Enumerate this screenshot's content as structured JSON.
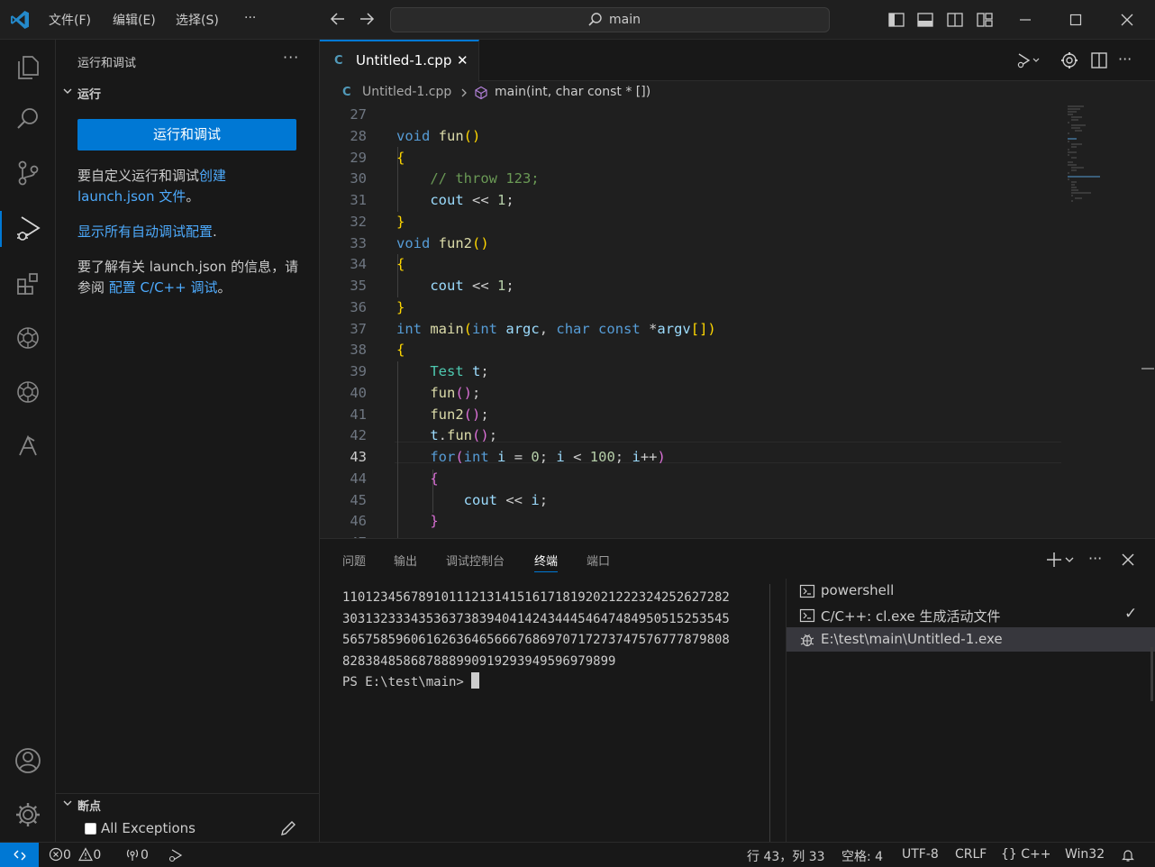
{
  "menu": [
    "文件(F)",
    "编辑(E)",
    "选择(S)",
    "···"
  ],
  "search": {
    "text": "main"
  },
  "sidebar": {
    "title": "运行和调试",
    "more": "···",
    "run_section": "运行",
    "run_button": "运行和调试",
    "customize_prefix": "要自定义运行和调试",
    "customize_link": "创建 launch.json 文件",
    "customize_suffix": "。",
    "show_all_link": "显示所有自动调试配置",
    "show_all_suffix": ".",
    "learn_prefix": "要了解有关 launch.json 的信息，请参阅 ",
    "learn_link": "配置 C/C++ 调试",
    "learn_suffix": "。",
    "breakpoints_section": "断点",
    "all_exceptions": "All Exceptions"
  },
  "editor": {
    "tab_icon": "C",
    "tab_label": "Untitled-1.cpp",
    "tab_close": "✕",
    "breadcrumb_file": "Untitled-1.cpp",
    "breadcrumb_symbol": "main(int, char const * [])",
    "current_line": 43,
    "lines": [
      {
        "n": "27",
        "t": ""
      },
      {
        "n": "28",
        "t": "void fun()"
      },
      {
        "n": "29",
        "t": "{"
      },
      {
        "n": "30",
        "t": "    // throw 123;"
      },
      {
        "n": "31",
        "t": "    cout << 1;"
      },
      {
        "n": "32",
        "t": "}"
      },
      {
        "n": "33",
        "t": "void fun2()"
      },
      {
        "n": "34",
        "t": "{"
      },
      {
        "n": "35",
        "t": "    cout << 1;"
      },
      {
        "n": "36",
        "t": "}"
      },
      {
        "n": "37",
        "t": "int main(int argc, char const *argv[])"
      },
      {
        "n": "38",
        "t": "{"
      },
      {
        "n": "39",
        "t": "    Test t;"
      },
      {
        "n": "40",
        "t": "    fun();"
      },
      {
        "n": "41",
        "t": "    fun2();"
      },
      {
        "n": "42",
        "t": "    t.fun();"
      },
      {
        "n": "43",
        "t": "    for(int i = 0; i < 100; i++)"
      },
      {
        "n": "44",
        "t": "    {"
      },
      {
        "n": "45",
        "t": "        cout << i;"
      },
      {
        "n": "46",
        "t": "    }"
      },
      {
        "n": "47",
        "t": ""
      }
    ]
  },
  "panel": {
    "tabs": [
      "问题",
      "输出",
      "调试控制台",
      "终端",
      "端口"
    ],
    "active_tab": "终端",
    "terminal_lines": [
      "110123456789101112131415161718192021222324252627282930313233343536373839404142434445464748495051525354555657585960616263646566676869707172737475767778798081828384858687888990919293949596979899",
      "303132333435363738394041424344454647484950515253545556575859606162636465666768697071727374757677787980818283848586878889909192939495969798999",
      "5657585960616263646566676869707172737475767778798081",
      "828384858687888990919293949596979899",
      "PS E:\\test\\main> "
    ],
    "terminal_display": [
      "110123456789101112131415161718192021222324252627282",
      "303132333435363738394041424344454647484950515253545",
      "565758596061626364656667686970717273747576777879808",
      "828384858687888990919293949596979899",
      "PS E:\\test\\main> "
    ],
    "terminals": [
      {
        "label": "powershell",
        "icon": "terminal-icon"
      },
      {
        "label": "C/C++: cl.exe 生成活动文件",
        "icon": "terminal-icon",
        "check": "✓"
      },
      {
        "label": "E:\\test\\main\\Untitled-1.exe",
        "icon": "debug-icon"
      }
    ]
  },
  "statusbar": {
    "errors": "0",
    "warnings": "0",
    "ports": "0",
    "position": "行 43，列 33",
    "spaces": "空格: 4",
    "encoding": "UTF-8",
    "eol": "CRLF",
    "language": "C++",
    "language_icon": "{}",
    "platform": "Win32"
  }
}
